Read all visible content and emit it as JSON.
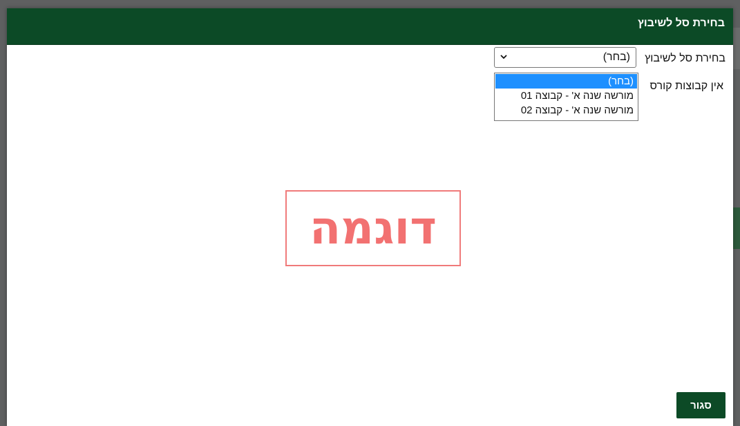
{
  "modal": {
    "title": "בחירת סל לשיבוץ"
  },
  "form": {
    "field_label": "בחירת סל לשיבוץ",
    "select_value": "(בחר)",
    "no_groups_text": "אין קבוצות קורס"
  },
  "dropdown": {
    "options": [
      "(בחר)",
      "מורשה שנה א' - קבוצה 01",
      "מורשה שנה א' - קבוצה 02"
    ],
    "selected_index": 0
  },
  "watermark": {
    "text": "דוגמה"
  },
  "footer": {
    "close_label": "סגור"
  },
  "colors": {
    "header_bg": "#0c4a26",
    "button_bg": "#0c4a26",
    "selected_option_bg": "#1e90ff",
    "watermark": "#f27171"
  }
}
